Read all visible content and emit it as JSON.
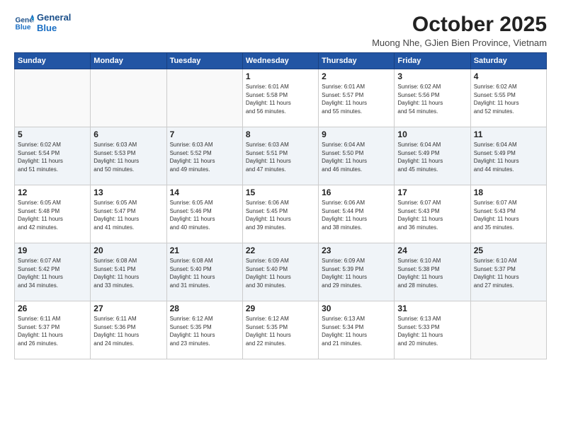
{
  "header": {
    "logo_line1": "General",
    "logo_line2": "Blue",
    "month": "October 2025",
    "location": "Muong Nhe, GJien Bien Province, Vietnam"
  },
  "days_of_week": [
    "Sunday",
    "Monday",
    "Tuesday",
    "Wednesday",
    "Thursday",
    "Friday",
    "Saturday"
  ],
  "weeks": [
    [
      {
        "day": "",
        "info": ""
      },
      {
        "day": "",
        "info": ""
      },
      {
        "day": "",
        "info": ""
      },
      {
        "day": "1",
        "info": "Sunrise: 6:01 AM\nSunset: 5:58 PM\nDaylight: 11 hours\nand 56 minutes."
      },
      {
        "day": "2",
        "info": "Sunrise: 6:01 AM\nSunset: 5:57 PM\nDaylight: 11 hours\nand 55 minutes."
      },
      {
        "day": "3",
        "info": "Sunrise: 6:02 AM\nSunset: 5:56 PM\nDaylight: 11 hours\nand 54 minutes."
      },
      {
        "day": "4",
        "info": "Sunrise: 6:02 AM\nSunset: 5:55 PM\nDaylight: 11 hours\nand 52 minutes."
      }
    ],
    [
      {
        "day": "5",
        "info": "Sunrise: 6:02 AM\nSunset: 5:54 PM\nDaylight: 11 hours\nand 51 minutes."
      },
      {
        "day": "6",
        "info": "Sunrise: 6:03 AM\nSunset: 5:53 PM\nDaylight: 11 hours\nand 50 minutes."
      },
      {
        "day": "7",
        "info": "Sunrise: 6:03 AM\nSunset: 5:52 PM\nDaylight: 11 hours\nand 49 minutes."
      },
      {
        "day": "8",
        "info": "Sunrise: 6:03 AM\nSunset: 5:51 PM\nDaylight: 11 hours\nand 47 minutes."
      },
      {
        "day": "9",
        "info": "Sunrise: 6:04 AM\nSunset: 5:50 PM\nDaylight: 11 hours\nand 46 minutes."
      },
      {
        "day": "10",
        "info": "Sunrise: 6:04 AM\nSunset: 5:49 PM\nDaylight: 11 hours\nand 45 minutes."
      },
      {
        "day": "11",
        "info": "Sunrise: 6:04 AM\nSunset: 5:49 PM\nDaylight: 11 hours\nand 44 minutes."
      }
    ],
    [
      {
        "day": "12",
        "info": "Sunrise: 6:05 AM\nSunset: 5:48 PM\nDaylight: 11 hours\nand 42 minutes."
      },
      {
        "day": "13",
        "info": "Sunrise: 6:05 AM\nSunset: 5:47 PM\nDaylight: 11 hours\nand 41 minutes."
      },
      {
        "day": "14",
        "info": "Sunrise: 6:05 AM\nSunset: 5:46 PM\nDaylight: 11 hours\nand 40 minutes."
      },
      {
        "day": "15",
        "info": "Sunrise: 6:06 AM\nSunset: 5:45 PM\nDaylight: 11 hours\nand 39 minutes."
      },
      {
        "day": "16",
        "info": "Sunrise: 6:06 AM\nSunset: 5:44 PM\nDaylight: 11 hours\nand 38 minutes."
      },
      {
        "day": "17",
        "info": "Sunrise: 6:07 AM\nSunset: 5:43 PM\nDaylight: 11 hours\nand 36 minutes."
      },
      {
        "day": "18",
        "info": "Sunrise: 6:07 AM\nSunset: 5:43 PM\nDaylight: 11 hours\nand 35 minutes."
      }
    ],
    [
      {
        "day": "19",
        "info": "Sunrise: 6:07 AM\nSunset: 5:42 PM\nDaylight: 11 hours\nand 34 minutes."
      },
      {
        "day": "20",
        "info": "Sunrise: 6:08 AM\nSunset: 5:41 PM\nDaylight: 11 hours\nand 33 minutes."
      },
      {
        "day": "21",
        "info": "Sunrise: 6:08 AM\nSunset: 5:40 PM\nDaylight: 11 hours\nand 31 minutes."
      },
      {
        "day": "22",
        "info": "Sunrise: 6:09 AM\nSunset: 5:40 PM\nDaylight: 11 hours\nand 30 minutes."
      },
      {
        "day": "23",
        "info": "Sunrise: 6:09 AM\nSunset: 5:39 PM\nDaylight: 11 hours\nand 29 minutes."
      },
      {
        "day": "24",
        "info": "Sunrise: 6:10 AM\nSunset: 5:38 PM\nDaylight: 11 hours\nand 28 minutes."
      },
      {
        "day": "25",
        "info": "Sunrise: 6:10 AM\nSunset: 5:37 PM\nDaylight: 11 hours\nand 27 minutes."
      }
    ],
    [
      {
        "day": "26",
        "info": "Sunrise: 6:11 AM\nSunset: 5:37 PM\nDaylight: 11 hours\nand 26 minutes."
      },
      {
        "day": "27",
        "info": "Sunrise: 6:11 AM\nSunset: 5:36 PM\nDaylight: 11 hours\nand 24 minutes."
      },
      {
        "day": "28",
        "info": "Sunrise: 6:12 AM\nSunset: 5:35 PM\nDaylight: 11 hours\nand 23 minutes."
      },
      {
        "day": "29",
        "info": "Sunrise: 6:12 AM\nSunset: 5:35 PM\nDaylight: 11 hours\nand 22 minutes."
      },
      {
        "day": "30",
        "info": "Sunrise: 6:13 AM\nSunset: 5:34 PM\nDaylight: 11 hours\nand 21 minutes."
      },
      {
        "day": "31",
        "info": "Sunrise: 6:13 AM\nSunset: 5:33 PM\nDaylight: 11 hours\nand 20 minutes."
      },
      {
        "day": "",
        "info": ""
      }
    ]
  ]
}
